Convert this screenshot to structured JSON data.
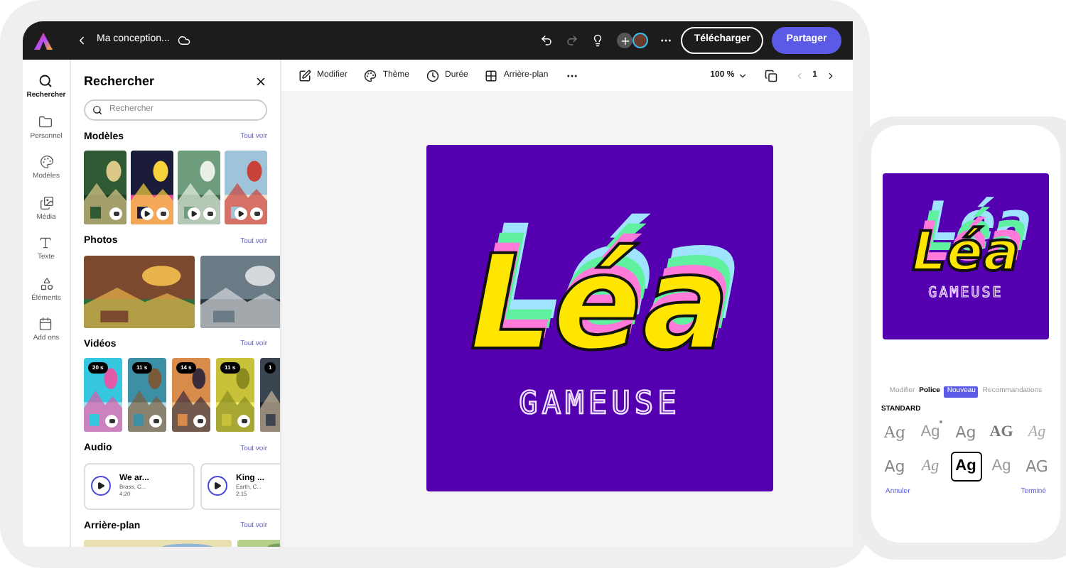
{
  "topbar": {
    "document_title": "Ma conception...",
    "download": "Télécharger",
    "share": "Partager"
  },
  "rail": [
    {
      "label": "Rechercher",
      "kind": "search",
      "selected": true
    },
    {
      "label": "Personnel",
      "kind": "folder",
      "selected": false
    },
    {
      "label": "Modèles",
      "kind": "palette",
      "selected": false
    },
    {
      "label": "Média",
      "kind": "media",
      "selected": false
    },
    {
      "label": "Texte",
      "kind": "text",
      "selected": false
    },
    {
      "label": "Éléments",
      "kind": "shapes",
      "selected": false
    },
    {
      "label": "Add ons",
      "kind": "addons",
      "selected": false
    }
  ],
  "panel": {
    "title": "Rechercher",
    "search": {
      "placeholder": "Rechercher"
    },
    "sections": [
      {
        "title": "Modèles",
        "see_all": "Tout voir",
        "kind": "templates"
      },
      {
        "title": "Photos",
        "see_all": "Tout voir",
        "kind": "photos"
      },
      {
        "title": "Vidéos",
        "see_all": "Tout voir",
        "kind": "videos",
        "durations": [
          "20 s",
          "11 s",
          "14 s",
          "11 s",
          "1"
        ]
      },
      {
        "title": "Audio",
        "see_all": "Tout voir",
        "kind": "audio",
        "tracks": [
          {
            "title": "We ar...",
            "artist": "Brass, C...",
            "length": "4:20"
          },
          {
            "title": "King ...",
            "artist": "Earth, C...",
            "length": "2:15"
          }
        ]
      },
      {
        "title": "Arrière-plan",
        "see_all": "Tout voir",
        "kind": "backgrounds"
      }
    ]
  },
  "toolbar": {
    "items": [
      {
        "label": "Modifier",
        "kind": "edit"
      },
      {
        "label": "Thème",
        "kind": "theme"
      },
      {
        "label": "Durée",
        "kind": "duration"
      },
      {
        "label": "Arrière-plan",
        "kind": "background"
      }
    ],
    "zoom": "100 %",
    "page": "1"
  },
  "canvas": {
    "title": "Léa",
    "subtitle": "GAMEUSE"
  },
  "phone": {
    "preview": {
      "title": "Léa",
      "subtitle": "GAMEUSE"
    },
    "tabs": [
      {
        "label": "Modifier",
        "selected": false
      },
      {
        "label": "Police",
        "selected": true
      },
      {
        "label": "Recommandations",
        "selected": false,
        "badge": "Nouveau"
      }
    ],
    "section": "STANDARD",
    "fonts": [
      {
        "sample": "Ag",
        "kind": "serif",
        "selected": false,
        "marked": false
      },
      {
        "sample": "Ag",
        "kind": "thin",
        "selected": false,
        "marked": true
      },
      {
        "sample": "Ag",
        "kind": "sans",
        "selected": false,
        "marked": false
      },
      {
        "sample": "AG",
        "kind": "stencil",
        "selected": false,
        "marked": false
      },
      {
        "sample": "Ag",
        "kind": "tiny",
        "selected": false,
        "marked": false
      },
      {
        "sample": "Ag",
        "kind": "sans",
        "selected": false,
        "marked": false
      },
      {
        "sample": "Ag",
        "kind": "script",
        "selected": false,
        "marked": false
      },
      {
        "sample": "Ag",
        "kind": "bold",
        "selected": true,
        "marked": false
      },
      {
        "sample": "Ag",
        "kind": "thin",
        "selected": false,
        "marked": false
      },
      {
        "sample": "AG",
        "kind": "sans",
        "selected": false,
        "marked": false
      }
    ],
    "cancel": "Annuler",
    "done": "Terminé"
  }
}
